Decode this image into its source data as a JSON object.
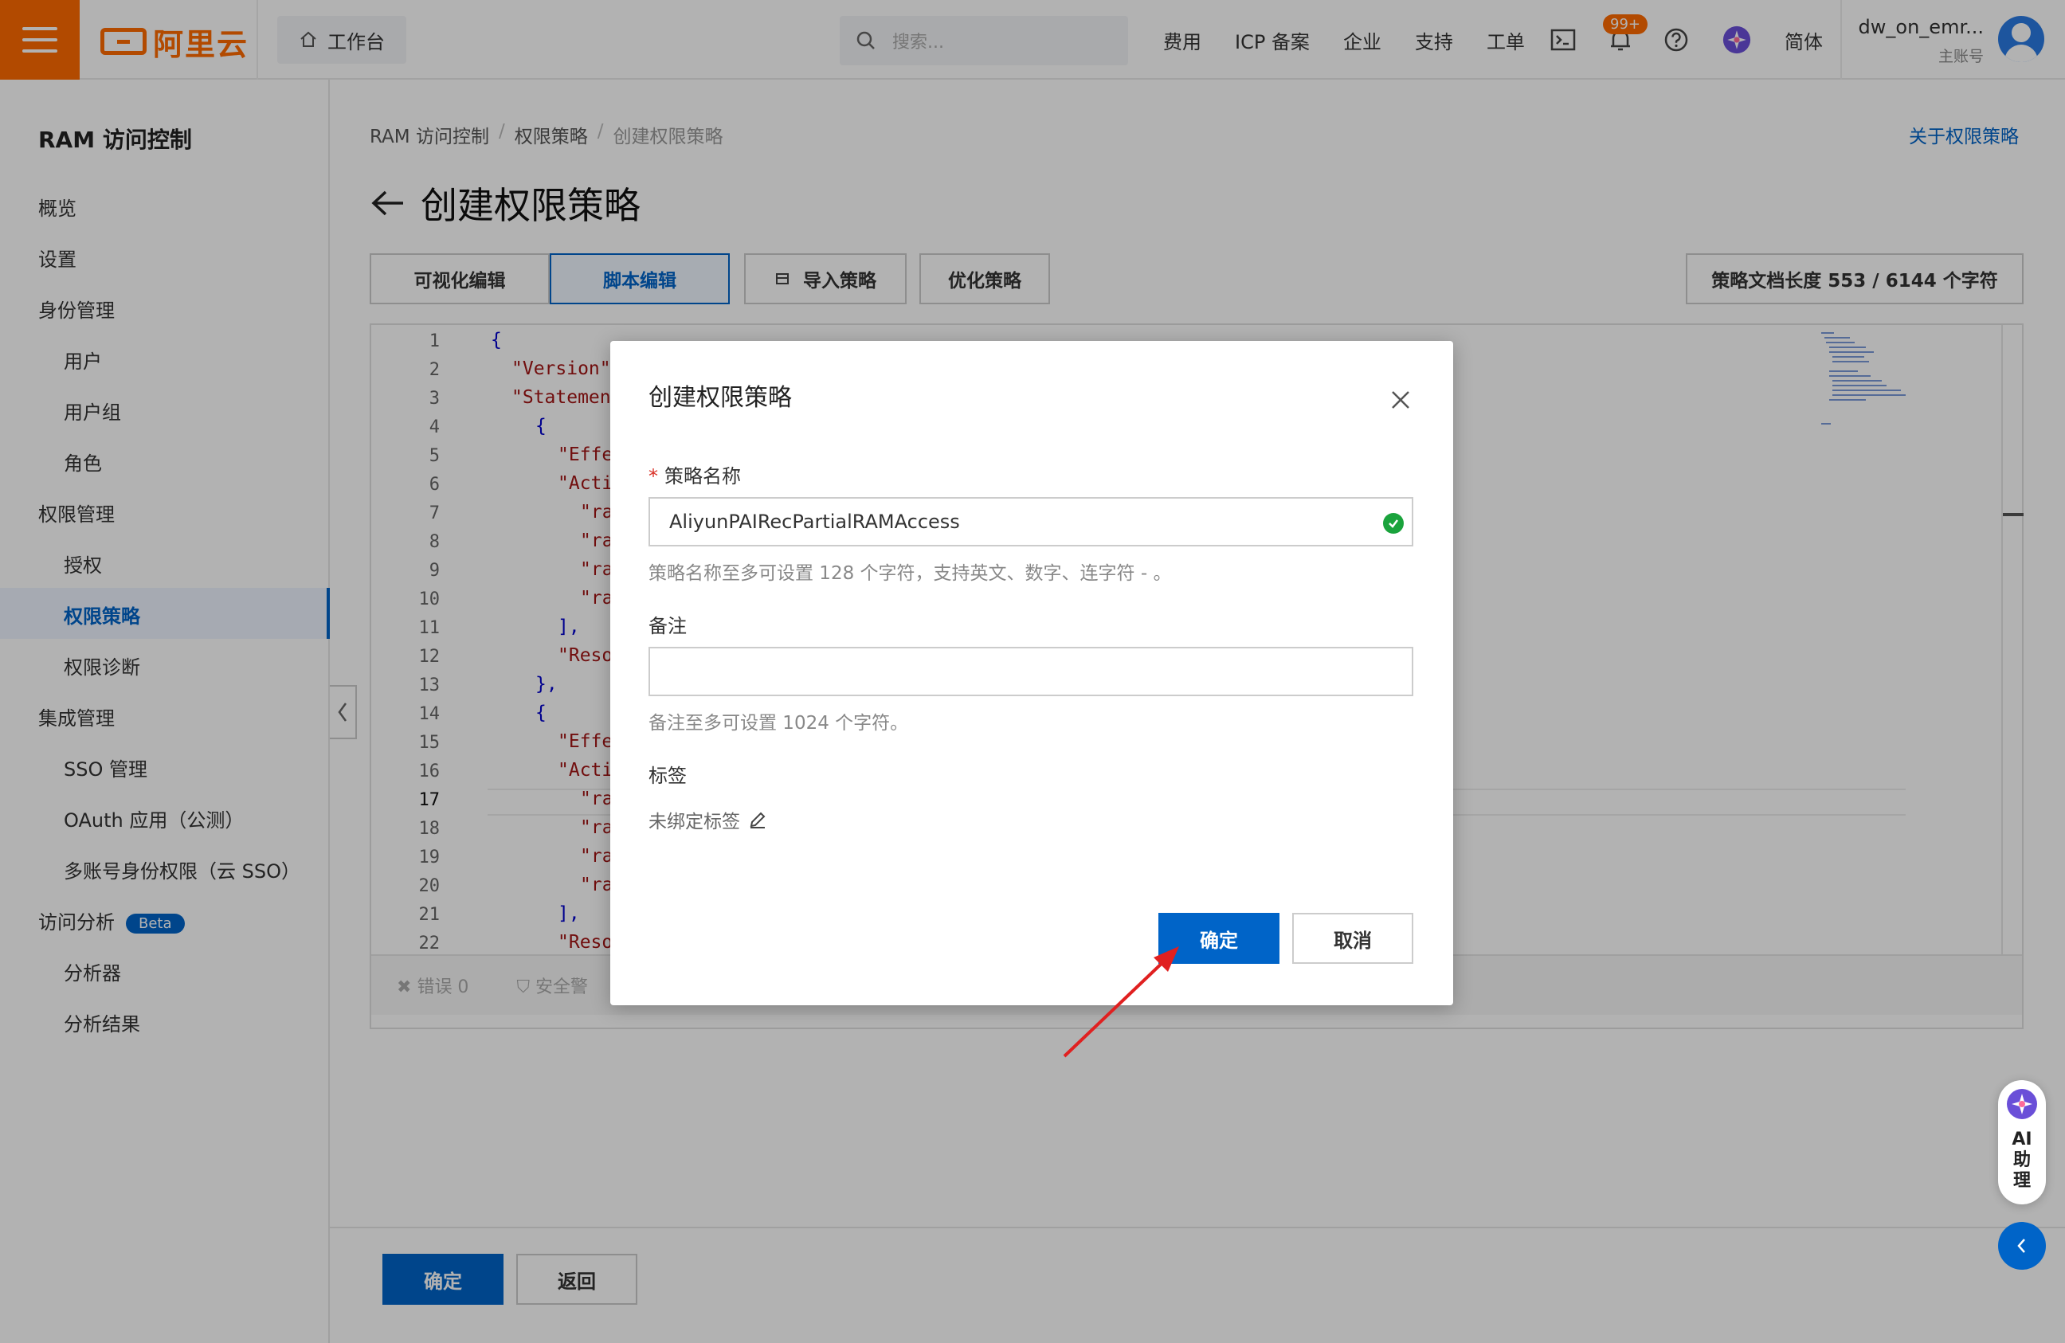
{
  "header": {
    "logo_text": "阿里云",
    "workbench_label": "工作台",
    "search_placeholder": "搜索...",
    "nav": [
      "费用",
      "ICP 备案",
      "企业",
      "支持",
      "工单"
    ],
    "notification_badge": "99+",
    "language": "简体",
    "user_name": "dw_on_emr...",
    "user_role": "主账号"
  },
  "sidebar": {
    "title": "RAM 访问控制",
    "items": [
      {
        "label": "概览"
      },
      {
        "label": "设置"
      },
      {
        "label": "身份管理"
      },
      {
        "label": "用户"
      },
      {
        "label": "用户组"
      },
      {
        "label": "角色"
      },
      {
        "label": "权限管理"
      },
      {
        "label": "授权"
      },
      {
        "label": "权限策略",
        "active": true
      },
      {
        "label": "权限诊断"
      },
      {
        "label": "集成管理"
      },
      {
        "label": "SSO 管理"
      },
      {
        "label": "OAuth 应用（公测）"
      },
      {
        "label": "多账号身份权限（云 SSO）"
      },
      {
        "label": "访问分析"
      },
      {
        "label": "分析器"
      },
      {
        "label": "分析结果"
      }
    ],
    "beta_badge": "Beta"
  },
  "main": {
    "breadcrumb": [
      "RAM 访问控制",
      "权限策略",
      "创建权限策略"
    ],
    "about_link": "关于权限策略",
    "title": "创建权限策略",
    "tabs": [
      "可视化编辑",
      "脚本编辑",
      "导入策略",
      "优化策略"
    ],
    "doc_length": "策略文档长度 553 / 6144 个字符",
    "editor_lines": [
      "1",
      "2",
      "3",
      "4",
      "5",
      "6",
      "7",
      "8",
      "9",
      "10",
      "11",
      "12",
      "13",
      "14",
      "15",
      "16",
      "17",
      "18",
      "19",
      "20",
      "21",
      "22"
    ],
    "code": {
      "l1": "{",
      "l2": "\"Version\"",
      "l3": "\"Statemen",
      "l4": "{",
      "l5": "\"Effe",
      "l6": "\"Acti",
      "l7": "\"ra",
      "l8": "\"ra",
      "l9": "\"ra",
      "l10": "\"ra",
      "l11": "],",
      "l12": "\"Reso",
      "l13": "},",
      "l14": "{",
      "l15": "\"Effe",
      "l16": "\"Acti",
      "l17": "\"ra",
      "l18": "\"ra",
      "l19": "\"ra",
      "l20": "\"ra",
      "l21": "],",
      "l22": "\"Reso"
    },
    "footer_errors": "错误 0",
    "footer_security": "安全警",
    "confirm": "确定",
    "back": "返回"
  },
  "modal": {
    "title": "创建权限策略",
    "name_label": "策略名称",
    "name_value": "AliyunPAIRecPartialRAMAccess",
    "name_hint": "策略名称至多可设置 128 个字符，支持英文、数字、连字符 - 。",
    "note_label": "备注",
    "note_value": "",
    "note_hint": "备注至多可设置 1024 个字符。",
    "tag_label": "标签",
    "tag_value": "未绑定标签",
    "ok": "确定",
    "cancel": "取消"
  },
  "ai_assistant": "AI助理",
  "colors": {
    "brand": "#ff6a00",
    "primary": "#0064c8",
    "success": "#1aa33c",
    "annotation": "#e02020"
  }
}
